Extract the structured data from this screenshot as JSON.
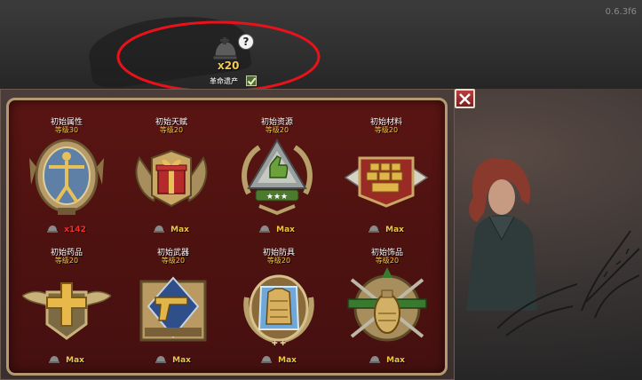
{
  "version": "0.6.3f6",
  "legacy": {
    "count": "x20",
    "label": "革命遗产",
    "help_glyph": "?",
    "checked": true
  },
  "colors": {
    "panel_bg": "#4d1210",
    "panel_border": "#b49a70",
    "level_text": "#f4c542",
    "max_text": "#f4c542",
    "cost_text": "#ff2a2a",
    "annotation": "#e8121b"
  },
  "cards": [
    {
      "title": "初始属性",
      "level": "等级30",
      "cost": "x142",
      "is_max": false,
      "icon": "vitruvian-medal-icon"
    },
    {
      "title": "初始天赋",
      "level": "等级20",
      "cost": "Max",
      "is_max": true,
      "icon": "gift-medal-icon"
    },
    {
      "title": "初始资源",
      "level": "等级20",
      "cost": "Max",
      "is_max": true,
      "icon": "thumbs-up-medal-icon"
    },
    {
      "title": "初始材料",
      "level": "等级20",
      "cost": "Max",
      "is_max": true,
      "icon": "gold-bars-medal-icon"
    },
    {
      "title": "初始药品",
      "level": "等级20",
      "cost": "Max",
      "is_max": true,
      "icon": "medical-cross-medal-icon"
    },
    {
      "title": "初始武器",
      "level": "等级20",
      "cost": "Max",
      "is_max": true,
      "icon": "pistol-medal-icon"
    },
    {
      "title": "初始防具",
      "level": "等级20",
      "cost": "Max",
      "is_max": true,
      "icon": "armor-medal-icon"
    },
    {
      "title": "初始饰品",
      "level": "等级20",
      "cost": "Max",
      "is_max": true,
      "icon": "grenade-medal-icon"
    }
  ]
}
